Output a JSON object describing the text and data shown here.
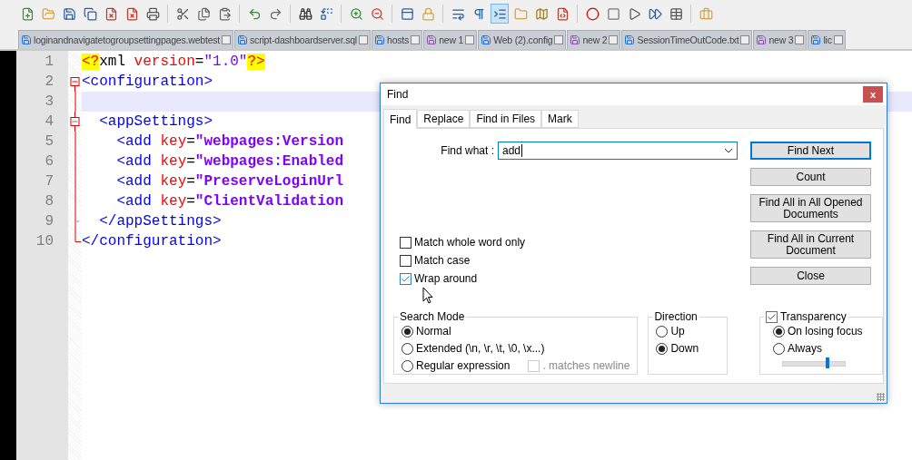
{
  "toolbar": [
    {
      "pressed": false
    },
    {
      "pressed": false
    },
    {
      "pressed": false
    },
    {
      "pressed": false
    },
    {
      "pressed": false
    },
    {
      "pressed": false
    },
    {
      "pressed": false
    },
    {
      "pressed": false
    },
    {
      "pressed": false
    },
    {
      "pressed": false
    },
    {
      "pressed": false
    },
    {
      "pressed": false
    },
    {
      "pressed": false
    },
    {
      "pressed": false
    },
    {
      "pressed": false
    },
    {
      "pressed": false
    },
    {
      "pressed": false
    },
    {
      "pressed": false
    },
    {
      "pressed": false
    },
    {
      "pressed": false
    },
    {
      "pressed": true
    },
    {
      "pressed": false
    },
    {
      "pressed": false
    },
    {
      "pressed": false
    },
    {
      "pressed": false
    },
    {
      "pressed": false
    },
    {
      "pressed": false
    },
    {
      "pressed": false
    },
    {
      "pressed": false
    },
    {
      "pressed": false
    }
  ],
  "tabs": [
    {
      "label": "loginandnavigatetogroupsettingpages.webtest",
      "saved": true
    },
    {
      "label": "script-dashboardserver.sql",
      "saved": true
    },
    {
      "label": "hosts",
      "saved": true
    },
    {
      "label": "new 1",
      "saved": false
    },
    {
      "label": "Web (2).config",
      "saved": true
    },
    {
      "label": "new 2",
      "saved": false
    },
    {
      "label": "SessionTimeOutCode.txt",
      "saved": true
    },
    {
      "label": "new 3",
      "saved": false
    },
    {
      "label": "lic",
      "saved": true
    }
  ],
  "editor": {
    "lines": [
      {
        "number": "1",
        "kind": "plain",
        "current": false,
        "tokens": [
          {
            "kind": "pi",
            "text": "<?"
          },
          {
            "kind": "plain",
            "text": "xml "
          },
          {
            "kind": "attr",
            "text": "version"
          },
          {
            "kind": "plain",
            "text": "="
          },
          {
            "kind": "string",
            "text": "\"1.0\""
          },
          {
            "kind": "pi",
            "text": "?>"
          }
        ]
      },
      {
        "number": "2",
        "kind": "fold-start",
        "current": false,
        "tokens": [
          {
            "kind": "tag",
            "text": "<configuration>"
          }
        ]
      },
      {
        "number": "3",
        "kind": "folded",
        "current": true
      },
      {
        "number": "4",
        "kind": "fold-inner-start",
        "current": false,
        "tokens": [
          {
            "kind": "tag",
            "text": "  <appSettings>"
          }
        ]
      },
      {
        "number": "5",
        "kind": "folded",
        "current": false,
        "tokens": [
          {
            "kind": "tag",
            "text": "    <add "
          },
          {
            "kind": "attr",
            "text": "key"
          },
          {
            "kind": "plain",
            "text": "="
          },
          {
            "kind": "value",
            "text": "\"webpages:Version"
          }
        ]
      },
      {
        "number": "6",
        "kind": "folded",
        "current": false,
        "tokens": [
          {
            "kind": "tag",
            "text": "    <add "
          },
          {
            "kind": "attr",
            "text": "key"
          },
          {
            "kind": "plain",
            "text": "="
          },
          {
            "kind": "value",
            "text": "\"webpages:Enabled"
          }
        ]
      },
      {
        "number": "7",
        "kind": "folded",
        "current": false,
        "tokens": [
          {
            "kind": "tag",
            "text": "    <add "
          },
          {
            "kind": "attr",
            "text": "key"
          },
          {
            "kind": "plain",
            "text": "="
          },
          {
            "kind": "value",
            "text": "\"PreserveLoginUrl"
          }
        ]
      },
      {
        "number": "8",
        "kind": "folded",
        "current": false,
        "tokens": [
          {
            "kind": "tag",
            "text": "    <add "
          },
          {
            "kind": "attr",
            "text": "key"
          },
          {
            "kind": "plain",
            "text": "="
          },
          {
            "kind": "value",
            "text": "\"ClientValidation"
          }
        ]
      },
      {
        "number": "9",
        "kind": "fold-inner-end",
        "current": false,
        "tokens": [
          {
            "kind": "tag",
            "text": "  </appSettings>"
          }
        ]
      },
      {
        "number": "10",
        "kind": "fold-end",
        "current": false,
        "tokens": [
          {
            "kind": "tag",
            "text": "</configuration>"
          }
        ]
      }
    ]
  },
  "dialog": {
    "title": "Find",
    "close": "x",
    "tabs": [
      {
        "label": "Find",
        "selected": true
      },
      {
        "label": "Replace",
        "selected": false
      },
      {
        "label": "Find in Files",
        "selected": false
      },
      {
        "label": "Mark",
        "selected": false
      }
    ],
    "find_what": {
      "label": "Find what :",
      "value": "add"
    },
    "options": [
      {
        "label": "Match whole word only",
        "checked": false
      },
      {
        "label": "Match case",
        "checked": false
      },
      {
        "label": "Wrap around",
        "checked": true
      }
    ],
    "buttons": [
      {
        "label": "Find Next",
        "default": true
      },
      {
        "label": "Count",
        "default": false
      },
      {
        "label": "Find All in All Opened Documents",
        "default": false
      },
      {
        "label": "Find All in Current Document",
        "default": false
      },
      {
        "label": "Close",
        "default": false
      }
    ],
    "search_mode": {
      "title": "Search Mode",
      "modes": [
        {
          "label": "Normal",
          "selected": true
        },
        {
          "label": "Extended (\\n, \\r, \\t, \\0, \\x...)",
          "selected": false
        },
        {
          "label": "Regular expression",
          "selected": false
        }
      ],
      "matches_newline": {
        "label": ". matches newline",
        "checked": false,
        "disabled": true
      }
    },
    "direction": {
      "title": "Direction",
      "options": [
        {
          "label": "Up",
          "selected": false
        },
        {
          "label": "Down",
          "selected": true
        }
      ]
    },
    "transparency": {
      "label": "Transparency",
      "checked": true,
      "options": [
        {
          "label": "On losing focus",
          "selected": true
        },
        {
          "label": "Always",
          "selected": false
        }
      ],
      "level": 0.72
    }
  }
}
